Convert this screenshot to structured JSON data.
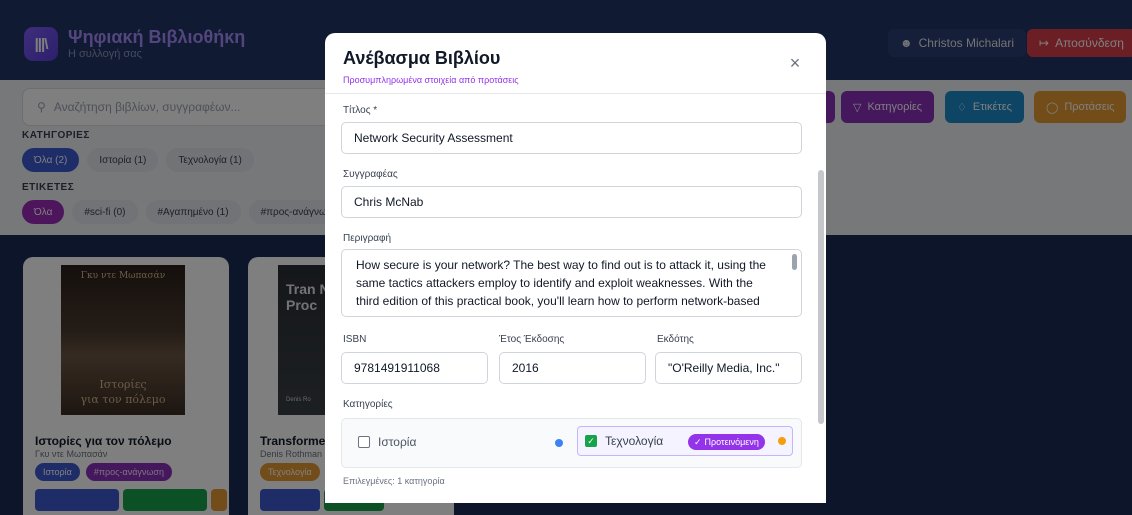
{
  "app": {
    "title": "Ψηφιακή Βιβλιοθήκη",
    "subtitle": "Η συλλογή σας",
    "logo": "|||\\",
    "user_name": "Christos Michalari",
    "logout_label": "Αποσύνδεση"
  },
  "search": {
    "placeholder": "Αναζήτηση βιβλίων, συγγραφέων..."
  },
  "filters": {
    "categories_label": "ΚΑΤΗΓΟΡΙΕΣ",
    "categories": [
      "Όλα (2)",
      "Ιστορία (1)",
      "Τεχνολογία (1)"
    ],
    "tags_label": "ΕΤΙΚΕΤΕΣ",
    "tags": [
      "Όλα",
      "#sci-fi (0)",
      "#Αγαπημένο (1)",
      "#προς-ανάγνωση"
    ]
  },
  "toolbar": {
    "categories_label": "Κατηγορίες",
    "tags_label": "Ετικέτες",
    "suggestions_label": "Προτάσεις"
  },
  "books": [
    {
      "title": "Ιστορίες για τον πόλεμο",
      "author": "Γκυ ντε Μωπασάν",
      "cover_author": "Γκυ ντε Μωπασάν",
      "cover_title_1": "Ιστορίες",
      "cover_title_2": "για τον πόλεμο",
      "category": "Ιστορία",
      "tag": "#προς-ανάγνωση"
    },
    {
      "title": "Transformers",
      "author": "Denis Rothman",
      "cover_title": "Tran Natu Proc",
      "cover_author": "Denis Ro",
      "category": "Τεχνολογία"
    }
  ],
  "modal": {
    "title": "Ανέβασμα Βιβλίου",
    "subtitle": "Προσυμπληρωμένα στοιχεία από προτάσεις",
    "close": "×",
    "fields": {
      "title_label": "Τίτλος *",
      "title_value": "Network Security Assessment",
      "author_label": "Συγγραφέας",
      "author_value": "Chris McNab",
      "description_label": "Περιγραφή",
      "description_value": "How secure is your network? The best way to find out is to attack it, using the same tactics attackers employ to identify and exploit weaknesses. With the third edition of this practical book, you'll learn how to perform network-based",
      "isbn_label": "ISBN",
      "isbn_value": "9781491911068",
      "year_label": "Έτος Έκδοσης",
      "year_value": "2016",
      "publisher_label": "Εκδότης",
      "publisher_value": "\"O'Reilly Media, Inc.\"",
      "categories_label": "Κατηγορίες",
      "category_history": "Ιστορία",
      "category_tech": "Τεχνολογία",
      "suggested_badge": "Προτεινόμενη",
      "selected_count": "Επιλεγμένες: 1 κατηγορία"
    }
  },
  "colors": {
    "header_bg": "#233566",
    "page_bg": "#1b2a55",
    "accent_purple": "#9333ea",
    "danger": "#d63f4a",
    "history_dot": "#3b82f6",
    "tech_dot": "#f59e0b"
  }
}
